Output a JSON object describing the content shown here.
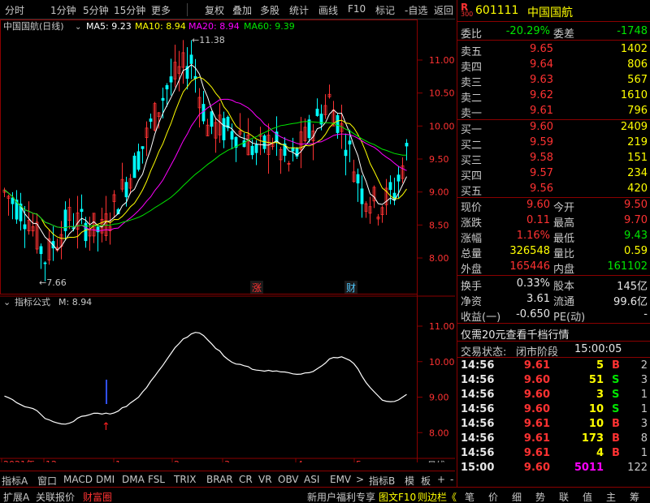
{
  "toolbar": {
    "items": [
      "分时",
      "1分钟",
      "5分钟",
      "15分钟",
      "更多",
      "复权",
      "叠加",
      "多股",
      "统计",
      "画线",
      "F10",
      "标记",
      "-自选",
      "返回"
    ]
  },
  "main_chart": {
    "title": "中国国航(日线)",
    "ma_labels": [
      {
        "text": "MA5: 9.23",
        "color": "#ffffff"
      },
      {
        "text": "MA10: 8.94",
        "color": "#ffff00"
      },
      {
        "text": "MA20: 8.94",
        "color": "#ff00ff"
      },
      {
        "text": "MA60: 9.39",
        "color": "#00e600"
      }
    ],
    "high_label": "11.38",
    "low_label": "7.66",
    "event_tags": [
      "涨",
      "财"
    ],
    "y_ticks": [
      "11.00",
      "10.50",
      "10.00",
      "9.50",
      "9.00",
      "8.50",
      "8.00"
    ]
  },
  "indicator": {
    "title": "指标公式",
    "value": "M: 8.94",
    "y_ticks": [
      "11.00",
      "10.00",
      "9.00",
      "8.00"
    ]
  },
  "date_axis": {
    "labels": [
      "2021年",
      "12",
      "1",
      "2",
      "3",
      "4",
      "5"
    ],
    "period": "日线"
  },
  "tabs_row1": [
    "指标A",
    "窗口",
    "MACD",
    "DMI",
    "DMA",
    "FSL",
    "TRIX",
    "BRAR",
    "CR",
    "VR",
    "OBV",
    "ASI",
    "EMV",
    ">",
    "指标B",
    "模",
    "板",
    "+",
    "-"
  ],
  "tabs_row2": {
    "left": [
      "扩展A",
      "关联报价",
      "财富圈"
    ],
    "middle": [
      "新用户福利专享",
      "图文F10",
      "则边栏《"
    ],
    "right": [
      "笔",
      "价",
      "细",
      "势",
      "联",
      "值",
      "主",
      "筹"
    ]
  },
  "quote": {
    "code": "601111",
    "name": "中国国航",
    "badge_top": "R",
    "badge_bot": "300",
    "wb_label": "委比",
    "wb_value": "-20.29%",
    "wc_label": "委差",
    "wc_value": "-1748",
    "asks": [
      {
        "label": "卖五",
        "price": "9.65",
        "vol": "1402"
      },
      {
        "label": "卖四",
        "price": "9.64",
        "vol": "806"
      },
      {
        "label": "卖三",
        "price": "9.63",
        "vol": "567"
      },
      {
        "label": "卖二",
        "price": "9.62",
        "vol": "1610"
      },
      {
        "label": "卖一",
        "price": "9.61",
        "vol": "796"
      }
    ],
    "bids": [
      {
        "label": "买一",
        "price": "9.60",
        "vol": "2409"
      },
      {
        "label": "买二",
        "price": "9.59",
        "vol": "219"
      },
      {
        "label": "买三",
        "price": "9.58",
        "vol": "151"
      },
      {
        "label": "买四",
        "price": "9.57",
        "vol": "234"
      },
      {
        "label": "买五",
        "price": "9.56",
        "vol": "420"
      }
    ],
    "stats": [
      {
        "l1": "现价",
        "v1": "9.60",
        "l2": "今开",
        "v2": "9.50"
      },
      {
        "l1": "涨跌",
        "v1": "0.11",
        "l2": "最高",
        "v2": "9.70"
      },
      {
        "l1": "涨幅",
        "v1": "1.16%",
        "l2": "最低",
        "v2": "9.43"
      },
      {
        "l1": "总量",
        "v1": "326548",
        "l2": "量比",
        "v2": "0.59"
      },
      {
        "l1": "外盘",
        "v1": "165446",
        "l2": "内盘",
        "v2": "161102"
      }
    ],
    "fin": [
      {
        "l1": "换手",
        "v1": "0.33%",
        "l2": "股本",
        "v2": "145亿"
      },
      {
        "l1": "净资",
        "v1": "3.61",
        "l2": "流通",
        "v2": "99.6亿"
      },
      {
        "l1": "收益(一)",
        "v1": "-0.650",
        "l2": "PE(动)",
        "v2": "-"
      }
    ],
    "promo": "仅需20元查看千档行情",
    "trade_status_label": "交易状态:",
    "trade_status": "闭市阶段",
    "trade_time": "15:00:05",
    "ticks": [
      {
        "time": "14:56",
        "price": "9.61",
        "vol": "5",
        "bs": "B",
        "n": "2"
      },
      {
        "time": "14:56",
        "price": "9.60",
        "vol": "51",
        "bs": "S",
        "n": "3"
      },
      {
        "time": "14:56",
        "price": "9.60",
        "vol": "3",
        "bs": "S",
        "n": "1"
      },
      {
        "time": "14:56",
        "price": "9.60",
        "vol": "10",
        "bs": "S",
        "n": "1"
      },
      {
        "time": "14:56",
        "price": "9.61",
        "vol": "10",
        "bs": "B",
        "n": "3"
      },
      {
        "time": "14:56",
        "price": "9.61",
        "vol": "173",
        "bs": "B",
        "n": "8"
      },
      {
        "time": "14:56",
        "price": "9.61",
        "vol": "4",
        "bs": "B",
        "n": "1"
      },
      {
        "time": "15:00",
        "price": "9.60",
        "vol": "5011",
        "bs": "",
        "n": "122"
      }
    ]
  }
}
